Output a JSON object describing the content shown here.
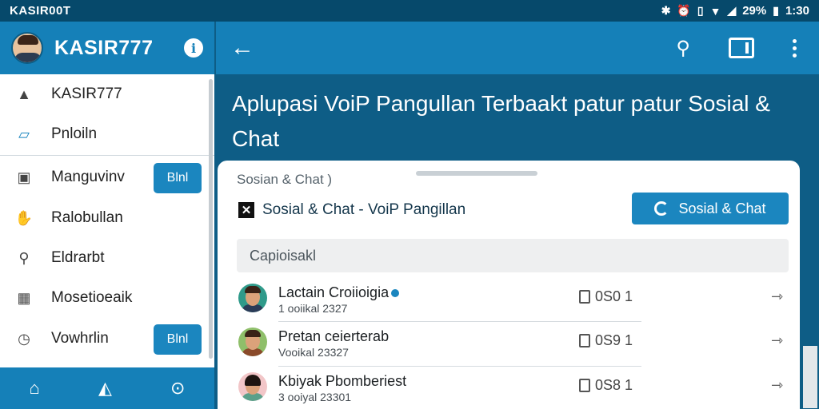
{
  "status_bar": {
    "carrier": "KASIR00T",
    "battery_text": "29%",
    "time": "1:30"
  },
  "drawer": {
    "title": "KASIR777",
    "items": [
      {
        "label": "KASIR777",
        "icon": "bag-icon"
      },
      {
        "label": "Pnloiln",
        "icon": "chat-icon"
      },
      {
        "label": "Manguvinv",
        "icon": "calendar-icon",
        "badge": "Blnl"
      },
      {
        "label": "Ralobullan",
        "icon": "hand-icon"
      },
      {
        "label": "Eldrarbt",
        "icon": "search-icon"
      },
      {
        "label": "Mosetioeaik",
        "icon": "calculator-icon"
      },
      {
        "label": "Vowhrlin",
        "icon": "clock-icon",
        "badge": "Blnl"
      }
    ],
    "bottom_nav": [
      "home-icon",
      "tools-icon",
      "location-icon"
    ]
  },
  "appbar": {
    "actions": [
      "search-icon",
      "cast-icon",
      "more-vert-icon"
    ]
  },
  "headline": "Aplupasi VoiP Pangullan Terbaakt patur patur Sosial & Chat",
  "card": {
    "breadcrumb": "Sosian & Chat )",
    "subtitle": "Sosial & Chat - VoiP Pangillan",
    "action_button": "Sosial & Chat",
    "search_placeholder": "Capioisakl",
    "rows": [
      {
        "name": "Lactain Croiioigia",
        "sub": "1 ooiikal 2327",
        "stat": "0S0 1",
        "online": true
      },
      {
        "name": "Pretan ceierterab",
        "sub": "Vooikal 23327",
        "stat": "0S9 1",
        "online": false
      },
      {
        "name": "Kbiyak Pbomberiest",
        "sub": "3 ooiyal 23301",
        "stat": "0S8 1",
        "online": false
      }
    ]
  },
  "colors": {
    "primary": "#1580b8",
    "dark": "#0e5d86",
    "status": "#06496b"
  }
}
